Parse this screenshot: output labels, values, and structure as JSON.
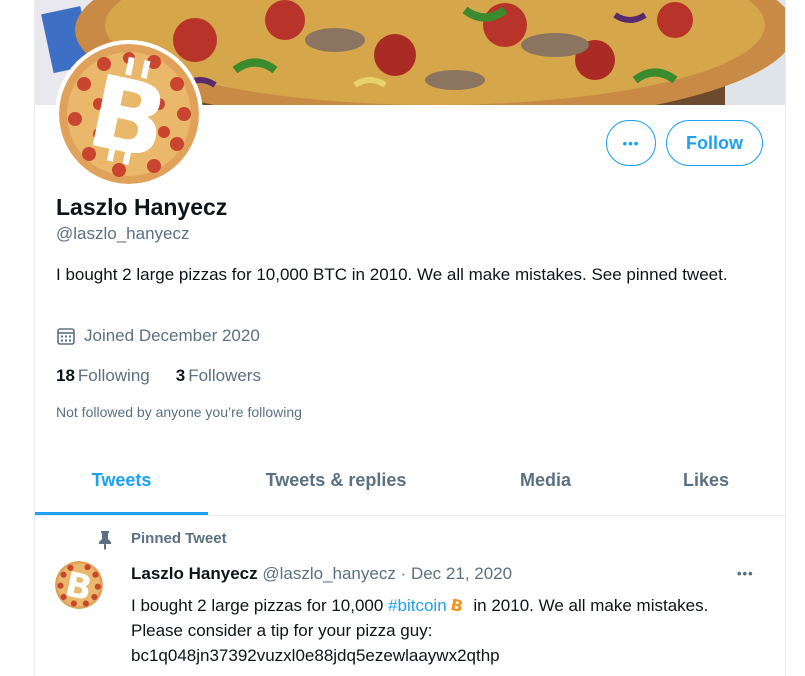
{
  "profile": {
    "name": "Laszlo Hanyecz",
    "handle": "@laszlo_hanyecz",
    "bio": "I bought 2 large pizzas for 10,000 BTC in 2010. We all make mistakes. See pinned tweet.",
    "joined": "Joined December 2020",
    "following_count": "18",
    "following_label": "Following",
    "followers_count": "3",
    "followers_label": "Followers",
    "not_followed": "Not followed by anyone you’re following"
  },
  "actions": {
    "more_label": "•••",
    "follow_label": "Follow"
  },
  "tabs": [
    {
      "label": "Tweets",
      "active": true
    },
    {
      "label": "Tweets & replies",
      "active": false
    },
    {
      "label": "Media",
      "active": false
    },
    {
      "label": "Likes",
      "active": false
    }
  ],
  "pinned_tweet": {
    "pinned_label": "Pinned Tweet",
    "author_name": "Laszlo Hanyecz",
    "author_handle": "@laszlo_hanyecz",
    "separator": " · ",
    "date": "Dec 21, 2020",
    "more_label": "•••",
    "text_part1": "I bought 2 large pizzas for 10,000 ",
    "hashtag": "#bitcoin",
    "text_part2": " in 2010. We all make mistakes. Please consider a tip for your pizza guy: bc1q048jn37392vuzxl0e88jdq5ezewlaaywx2qthp"
  },
  "colors": {
    "accent": "#1da1f2",
    "secondary_text": "#5b7083",
    "bitcoin_orange": "#f7931a"
  },
  "icons": {
    "calendar": "calendar-icon",
    "pin": "pin-icon",
    "bitcoin_emoji": "bitcoin-emoji-icon"
  }
}
